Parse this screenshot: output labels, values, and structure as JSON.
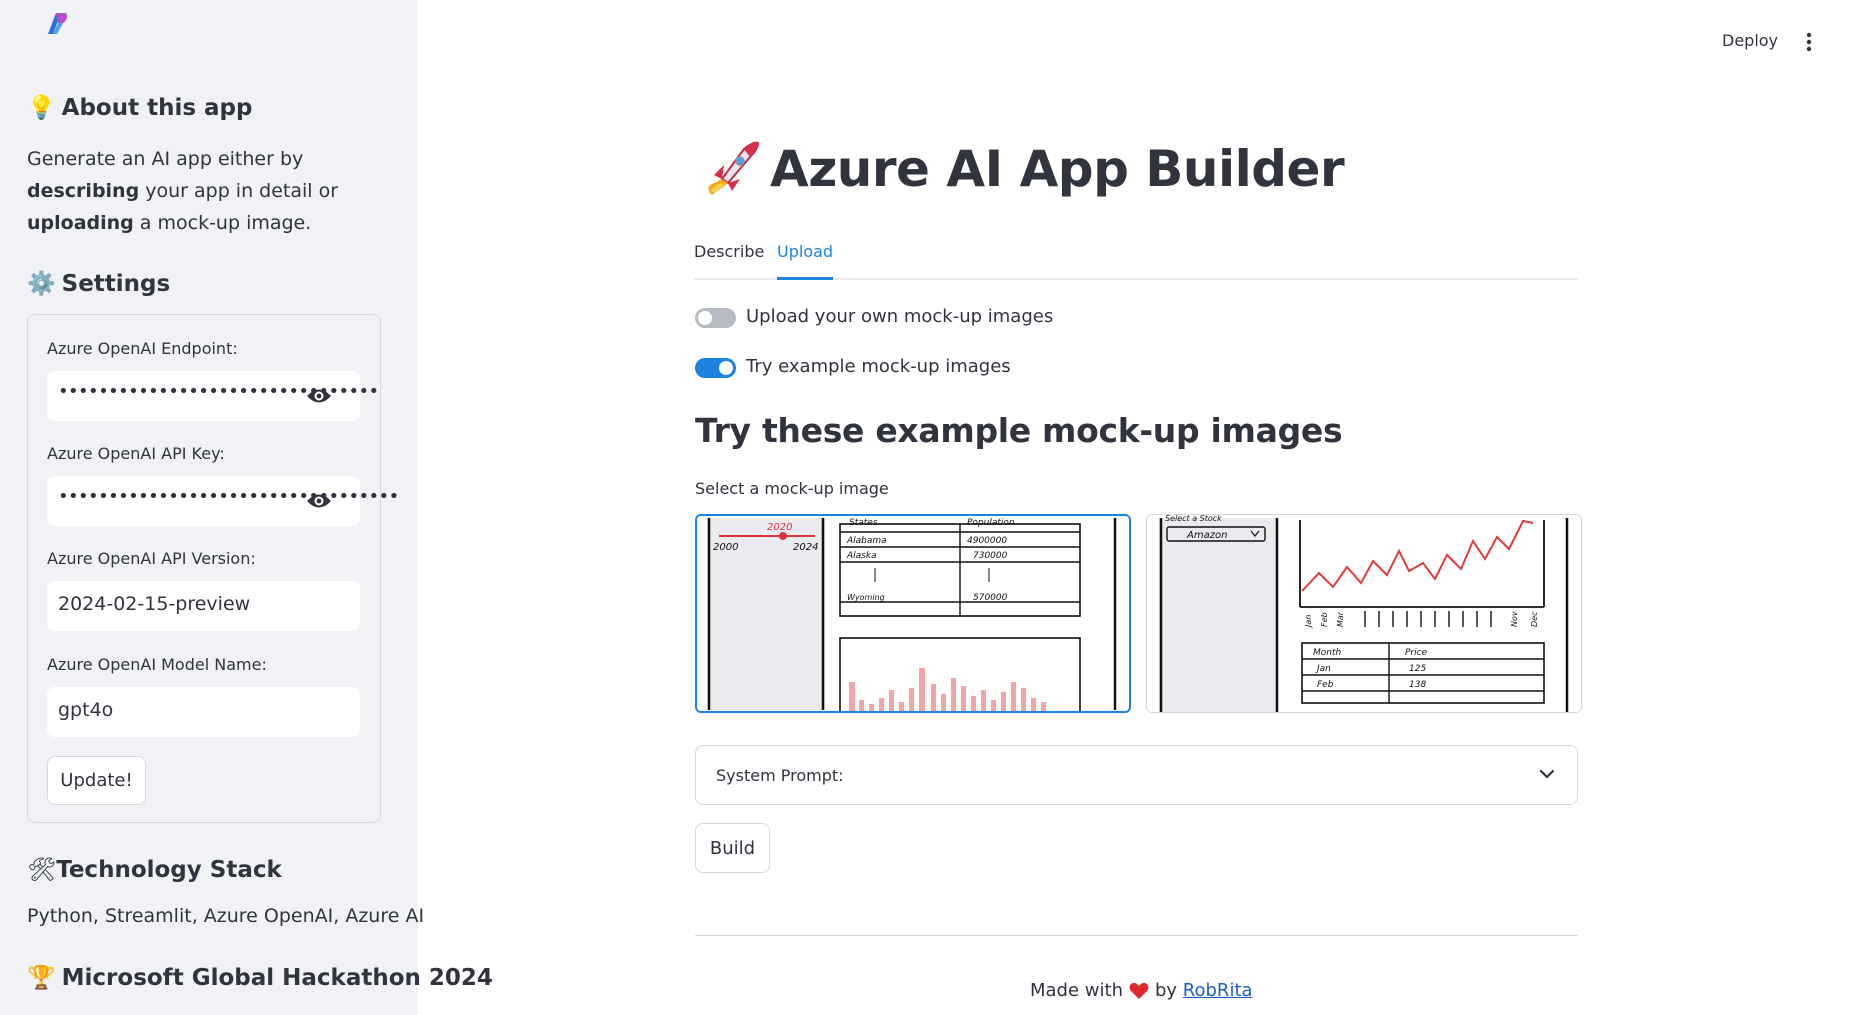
{
  "sidebar": {
    "about_title": "About this app",
    "about_icon": "lightbulb-icon",
    "about_text": {
      "p1": "Generate an AI app either by ",
      "b1": "describing",
      "p2": " your app in detail or ",
      "b2": "uploading",
      "p3": " a mock-up image."
    },
    "settings_title": "Settings",
    "settings_icon": "gear-icon",
    "fields": [
      {
        "label": "Azure OpenAI Endpoint:",
        "value": "••••••••••••••••••••••••••••••••",
        "type": "password"
      },
      {
        "label": "Azure OpenAI API Key:",
        "value": "••••••••••••••••••••••••••••••••••",
        "type": "password"
      },
      {
        "label": "Azure OpenAI API Version:",
        "value": "2024-02-15-preview",
        "type": "text"
      },
      {
        "label": "Azure OpenAI Model Name:",
        "value": "gpt4o",
        "type": "text"
      }
    ],
    "update_label": "Update!",
    "tech_title": "Technology Stack",
    "tech_icon": "tools-icon",
    "tech_text": "Python, Streamlit, Azure OpenAI, Azure AI",
    "hackathon_title": "Microsoft Global Hackathon 2024",
    "hackathon_icon": "trophy-icon"
  },
  "header": {
    "deploy_label": "Deploy",
    "menu_icon": "kebab-menu-icon"
  },
  "main": {
    "title": "Azure AI App Builder",
    "title_icon": "rocket-icon",
    "tabs": [
      {
        "label": "Describe",
        "active": false
      },
      {
        "label": "Upload",
        "active": true
      }
    ],
    "toggles": [
      {
        "label": "Upload your own mock-up images",
        "on": false
      },
      {
        "label": "Try example mock-up images",
        "on": true
      }
    ],
    "section_title": "Try these example mock-up images",
    "select_label": "Select a mock-up image",
    "mockups": [
      {
        "selected": true,
        "slider": {
          "min": "2000",
          "max": "2024",
          "value": "2020"
        },
        "table_headers": [
          "States",
          "Population"
        ],
        "table_rows": [
          [
            "Alabama",
            "4900000"
          ],
          [
            "Alaska",
            "730000"
          ],
          [
            "Wyoming",
            "570000"
          ]
        ]
      },
      {
        "selected": false,
        "select_label": "Select a Stock",
        "select_value": "Amazon",
        "x_labels": [
          "Jan",
          "Feb",
          "Mar",
          "Nov",
          "Dec"
        ],
        "table_headers": [
          "Month",
          "Price"
        ],
        "table_rows": [
          [
            "Jan",
            "125"
          ],
          [
            "Feb",
            "138"
          ]
        ]
      }
    ],
    "expander_label": "System Prompt:",
    "build_label": "Build",
    "footer": {
      "made_with": "Made with",
      "by": "by",
      "author": "RobRita"
    }
  },
  "colors": {
    "accent": "#1c83e1",
    "sidebar_bg": "#f0f2f6",
    "text": "#31333f",
    "link": "#1c5fc6",
    "heart": "#e0272d"
  }
}
